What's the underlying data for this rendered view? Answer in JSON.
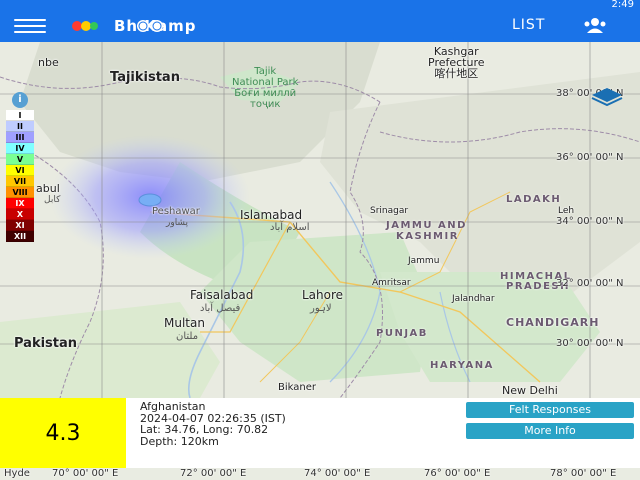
{
  "status": {
    "time": "2:49"
  },
  "app": {
    "brand": "Bh  Kamp",
    "list_label": "LIST",
    "colors": {
      "appbar": "#1a73e8",
      "magnitude_bg": "#ffff00",
      "button": "#29a3c6"
    }
  },
  "icons": {
    "menu": "hamburger-menu-icon",
    "user": "user-group-icon",
    "info": "info-icon",
    "layers": "layers-icon",
    "epicenter": "epicenter-marker-icon"
  },
  "legend": {
    "info_glyph": "i",
    "levels": [
      {
        "label": "I",
        "color": "#ffffff",
        "text_color": "#000000"
      },
      {
        "label": "II",
        "color": "#bfccff",
        "text_color": "#000000"
      },
      {
        "label": "III",
        "color": "#a0a0ff",
        "text_color": "#000000"
      },
      {
        "label": "IV",
        "color": "#80ffff",
        "text_color": "#000000"
      },
      {
        "label": "V",
        "color": "#7aff93",
        "text_color": "#000000"
      },
      {
        "label": "VI",
        "color": "#ffff00",
        "text_color": "#000000"
      },
      {
        "label": "VII",
        "color": "#ffc800",
        "text_color": "#000000"
      },
      {
        "label": "VIII",
        "color": "#ff9100",
        "text_color": "#000000"
      },
      {
        "label": "IX",
        "color": "#ff0000",
        "text_color": "#ffffff"
      },
      {
        "label": "X",
        "color": "#c80000",
        "text_color": "#ffffff"
      },
      {
        "label": "XI",
        "color": "#800000",
        "text_color": "#ffffff"
      },
      {
        "label": "XII",
        "color": "#400000",
        "text_color": "#ffffff"
      }
    ]
  },
  "map": {
    "countries": {
      "tajikistan": "Tajikistan",
      "pakistan": "Pakistan"
    },
    "park": {
      "line1": "Tajik",
      "line2": "National Park",
      "line3": "Боғи миллӣ",
      "line4": "тоҷик"
    },
    "kashgar": {
      "name": "Kashgar",
      "name2": "Prefecture",
      "native": "喀什地区"
    },
    "cities": {
      "dushanbe": "nbe",
      "kabul": "abul",
      "kabul_native": "کابل",
      "peshawar": "Peshawar",
      "peshawar_native": "پشاور",
      "islamabad": "Islamabad",
      "islamabad_native": "اسلام آباد",
      "srinagar": "Srinagar",
      "leh": "Leh",
      "jammu": "Jammu",
      "amritsar": "Amritsar",
      "faisalabad": "Faisalabad",
      "faisalabad_native": "فیصل آباد",
      "lahore": "Lahore",
      "lahore_native": "لاہور",
      "jalandhar": "Jalandhar",
      "chandigarh": "CHANDIGARH",
      "multan": "Multan",
      "multan_native": "ملتان",
      "bikaner": "Bikaner",
      "new_delhi": "New Delhi",
      "hyderabad": "Hyde"
    },
    "regions": {
      "ladakh": "LADAKH",
      "jammu_kashmir_1": "JAMMU AND",
      "jammu_kashmir_2": "KASHMIR",
      "himachal_1": "HIMACHAL",
      "himachal_2": "PRADESH",
      "punjab": "PUNJAB",
      "haryana": "HARYANA"
    },
    "latitudes": [
      "38° 00' 00\" N",
      "36° 00' 00\" N",
      "34° 00' 00\" N",
      "32° 00' 00\" N",
      "30° 00' 00\" N"
    ],
    "longitudes": [
      "70° 00' 00\" E",
      "72° 00' 00\" E",
      "74° 00' 00\" E",
      "76° 00' 00\" E",
      "78° 00' 00\" E"
    ]
  },
  "event": {
    "magnitude": "4.3",
    "location": "Afghanistan",
    "datetime": "2024-04-07 02:26:35 (IST)",
    "latlong": "Lat: 34.76, Long: 70.82",
    "depth": "Depth: 120km",
    "felt_label": "Felt Responses",
    "more_label": "More Info"
  }
}
